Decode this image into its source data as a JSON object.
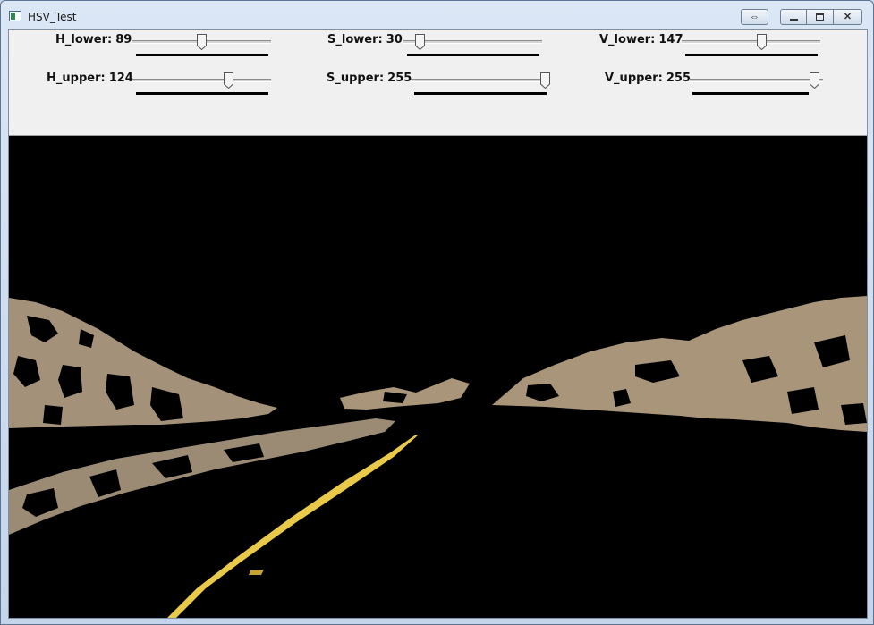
{
  "window": {
    "title": "HSV_Test"
  },
  "sliders": [
    {
      "id": "h-lower",
      "name": "H_lower:",
      "value": 89,
      "max": 179
    },
    {
      "id": "s-lower",
      "name": "S_lower:",
      "value": 30,
      "max": 255
    },
    {
      "id": "v-lower",
      "name": "V_lower:",
      "value": 147,
      "max": 255
    },
    {
      "id": "h-upper",
      "name": "H_upper:",
      "value": 124,
      "max": 179
    },
    {
      "id": "s-upper",
      "name": "S_upper:",
      "value": 255,
      "max": 255
    },
    {
      "id": "v-upper",
      "name": "V_upper:",
      "value": 255,
      "max": 255
    }
  ],
  "colors": {
    "road_line": "#e8c94a",
    "terrain": "#a8957a",
    "terrain_shadow": "#6f6350",
    "background": "#000000"
  }
}
